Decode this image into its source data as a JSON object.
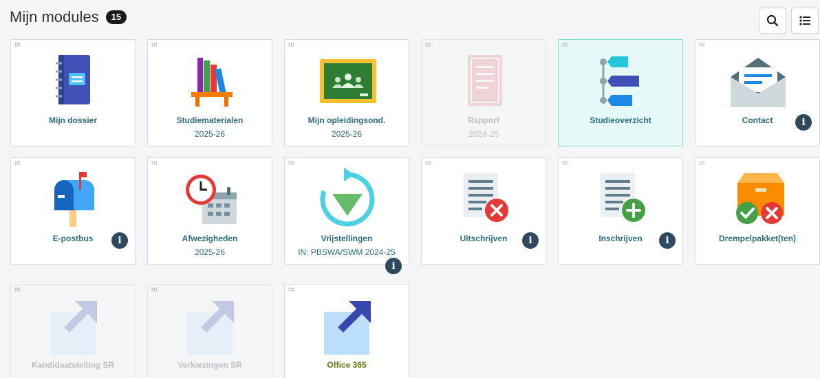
{
  "header": {
    "title": "Mijn modules",
    "count": "15"
  },
  "toolbar": {
    "search_icon": "search-icon",
    "list_icon": "list-icon"
  },
  "modules": [
    {
      "label": "Mijn dossier",
      "sub": "",
      "info": false,
      "state": "normal"
    },
    {
      "label": "Studiematerialen",
      "sub": "2025-26",
      "info": false,
      "state": "normal"
    },
    {
      "label": "Mijn opleidingsond.",
      "sub": "2025-26",
      "info": false,
      "state": "normal"
    },
    {
      "label": "Rapport",
      "sub": "2024-25",
      "info": false,
      "state": "disabled"
    },
    {
      "label": "Studieoverzicht",
      "sub": "",
      "info": false,
      "state": "selected"
    },
    {
      "label": "Contact",
      "sub": "",
      "info": true,
      "state": "normal"
    },
    {
      "label": "E-postbus",
      "sub": "",
      "info": true,
      "state": "normal"
    },
    {
      "label": "Afwezigheden",
      "sub": "2025-26",
      "info": false,
      "state": "normal"
    },
    {
      "label": "Vrijstellingen",
      "sub": "IN: PBSWA/SWM 2024-25",
      "info": true,
      "state": "normal"
    },
    {
      "label": "Uitschrijven",
      "sub": "",
      "info": true,
      "state": "normal"
    },
    {
      "label": "Inschrijven",
      "sub": "",
      "info": true,
      "state": "normal"
    },
    {
      "label": "Drempelpakket(ten)",
      "sub": "",
      "info": false,
      "state": "normal"
    },
    {
      "label": "Kandidaatstelling SR",
      "sub": "",
      "info": false,
      "state": "disabled"
    },
    {
      "label": "Verkiezingen SR",
      "sub": "",
      "info": false,
      "state": "disabled"
    },
    {
      "label": "Office 365",
      "sub": "",
      "info": false,
      "state": "normal"
    }
  ],
  "info_glyph": "i",
  "colors": {
    "label": "#2c6e7d",
    "office_label": "#5b7d0f",
    "info_badge": "#2f4a5f",
    "highlight_bg": "#e6fbf9"
  }
}
